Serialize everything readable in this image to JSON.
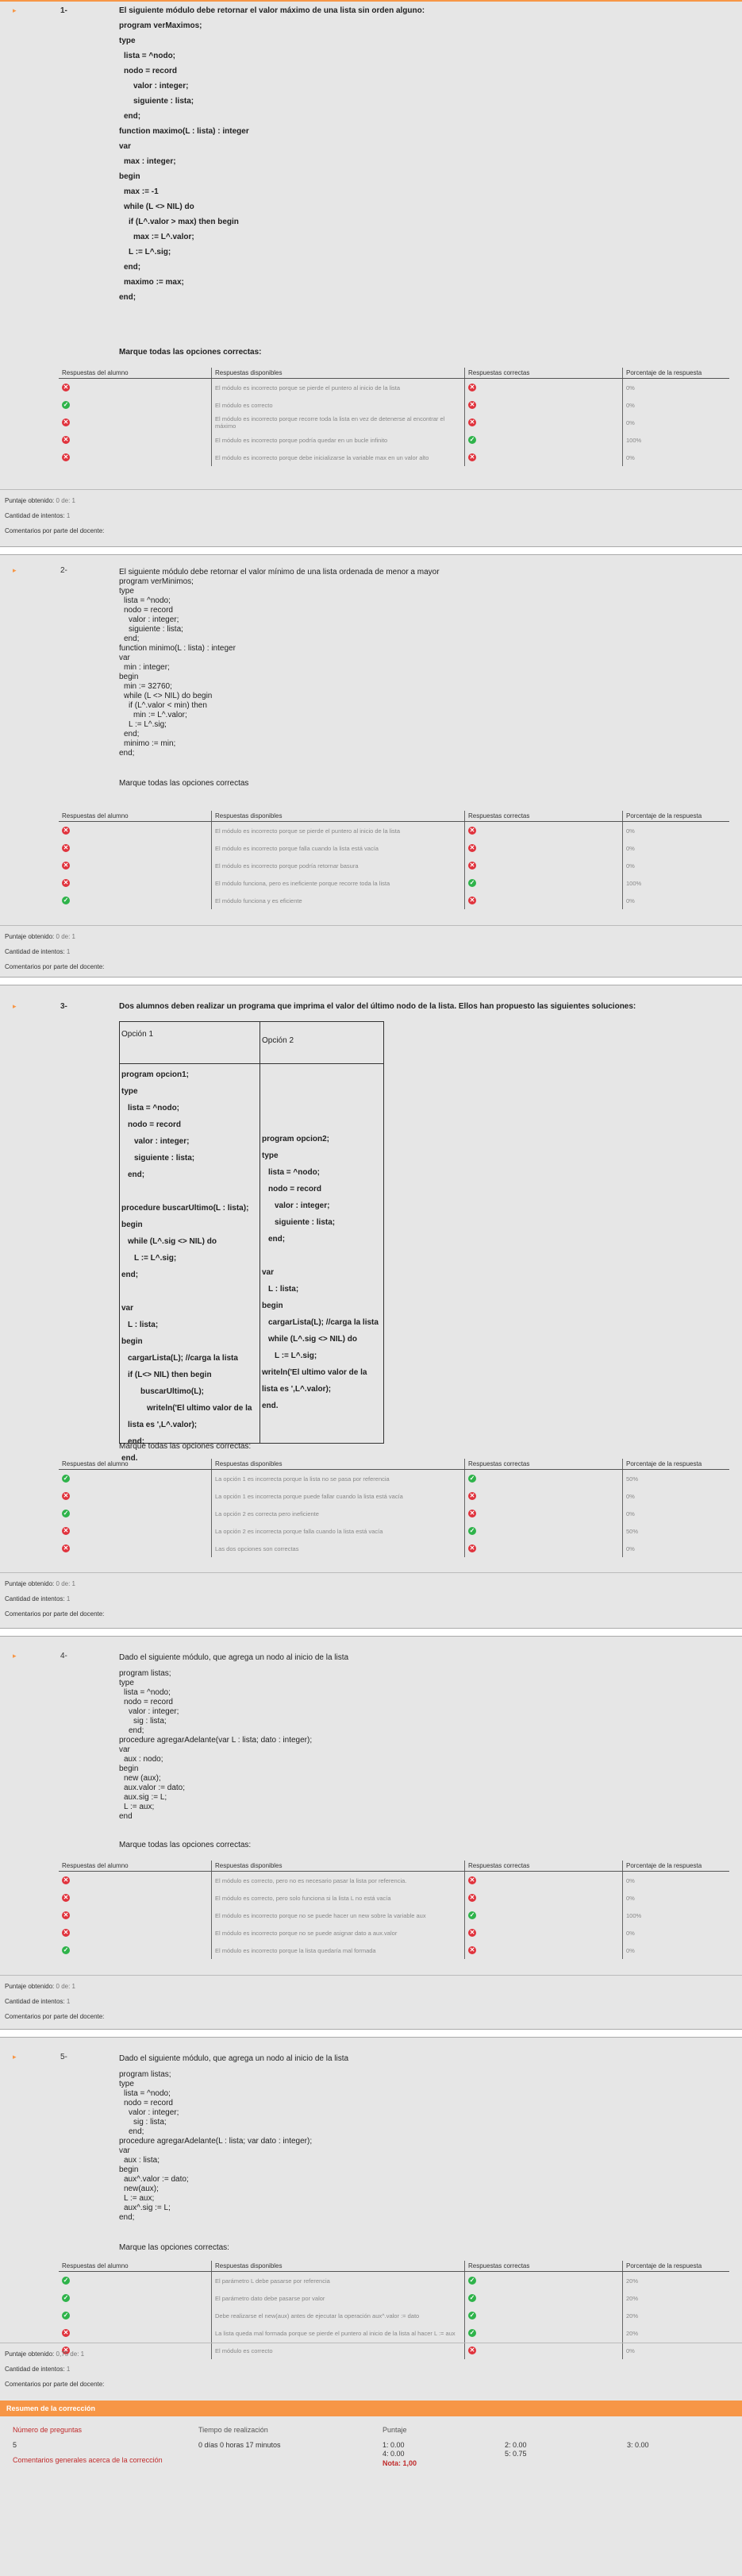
{
  "labels": {
    "student_answers": "Respuestas del alumno",
    "available_answers": "Respuestas disponibles",
    "correct_answers": "Respuestas correctas",
    "answer_percentage": "Porcentaje de la respuesta",
    "score_obtained": "Puntaje obtenido:",
    "attempts": "Cantidad de intentos:",
    "teacher_comments": "Comentarios por parte del docente:"
  },
  "q1": {
    "number": "1-",
    "statement": "El siguiente módulo debe retornar el valor máximo de una lista sin orden alguno:",
    "code": [
      "program verMaximos;",
      "type",
      "lista = ^nodo;",
      "nodo = record",
      "valor : integer;",
      "siguiente : lista;",
      "end;",
      "function maximo(L : lista) : integer",
      "var",
      "max : integer;",
      "begin",
      "max := -1",
      "while (L <> NIL) do",
      "if (L^.valor > max) then begin",
      "max := L^.valor;",
      "L := L^.sig;",
      "end;",
      "maximo := max;",
      "end;"
    ],
    "prompt": "Marque todas las opciones correctas:",
    "rows": [
      {
        "student": "bad",
        "text": "El módulo es incorrecto porque se pierde el puntero al inicio de la lista",
        "correct": "bad",
        "pct": "0%"
      },
      {
        "student": "ok",
        "text": "El módulo es correcto",
        "correct": "bad",
        "pct": "0%"
      },
      {
        "student": "bad",
        "text": "El módulo es incorrecto porque recorre toda la lista en vez de detenerse al encontrar el máximo",
        "correct": "bad",
        "pct": "0%"
      },
      {
        "student": "bad",
        "text": "El módulo es incorrecto porque podría quedar en un bucle infinito",
        "correct": "ok",
        "pct": "100%"
      },
      {
        "student": "bad",
        "text": "El módulo es incorrecto porque debe inicializarse la variable max en un valor alto",
        "correct": "bad",
        "pct": "0%"
      }
    ],
    "score": "0 de: 1",
    "attempts": "1"
  },
  "q2": {
    "number": "2-",
    "statement": "El siguiente módulo debe retornar el valor mínimo de una lista ordenada de menor a mayor",
    "code": [
      "program verMinimos;",
      "type",
      "lista = ^nodo;",
      "nodo = record",
      "valor : integer;",
      "siguiente : lista;",
      "end;",
      "function minimo(L : lista) : integer",
      "var",
      "min : integer;",
      "begin",
      "min := 32760;",
      "while (L <> NIL) do begin",
      "if (L^.valor < min) then",
      "min := L^.valor;",
      "L := L^.sig;",
      "end;",
      "minimo := min;",
      "end;"
    ],
    "prompt": "Marque todas las opciones correctas",
    "rows": [
      {
        "student": "bad",
        "text": "El módulo es incorrecto porque se pierde el puntero al inicio de la lista",
        "correct": "bad",
        "pct": "0%"
      },
      {
        "student": "bad",
        "text": "El módulo es incorrecto porque falla cuando la lista está vacía",
        "correct": "bad",
        "pct": "0%"
      },
      {
        "student": "bad",
        "text": "El módulo es incorrecto porque podría retornar basura",
        "correct": "bad",
        "pct": "0%"
      },
      {
        "student": "bad",
        "text": "El módulo funciona, pero es ineficiente porque recorre toda la lista",
        "correct": "ok",
        "pct": "100%"
      },
      {
        "student": "ok",
        "text": "El módulo funciona y es eficiente",
        "correct": "bad",
        "pct": "0%"
      }
    ],
    "score": "0 de: 1",
    "attempts": "1"
  },
  "q3": {
    "number": "3-",
    "statement": "Dos alumnos deben realizar un programa que imprima el valor del último nodo de la lista.  Ellos han propuesto las siguientes soluciones:",
    "opt1_header": "Opción 1",
    "opt2_header": "Opción 2",
    "opt1_code": [
      "program opcion1;",
      "type",
      "lista = ^nodo;",
      "nodo = record",
      "valor : integer;",
      "siguiente : lista;",
      "end;",
      "",
      "procedure buscarUltimo(L : lista);",
      "begin",
      "while (L^.sig <> NIL) do",
      "L := L^.sig;",
      "end;",
      "",
      "var",
      "L : lista;",
      "begin",
      "cargarLista(L); //carga la lista",
      "if (L<> NIL) then begin",
      "buscarUltimo(L);",
      "writeln('El ultimo valor de la",
      "lista es ',L^.valor);",
      "end;",
      "end."
    ],
    "opt2_code": [
      "program opcion2;",
      "type",
      "lista = ^nodo;",
      "nodo = record",
      "valor : integer;",
      "siguiente : lista;",
      "end;",
      "",
      "var",
      "L : lista;",
      "begin",
      "cargarLista(L); //carga la lista",
      "while (L^.sig <> NIL) do",
      "L := L^.sig;",
      "writeln('El ultimo valor de la",
      "lista es ',L^.valor);",
      "end."
    ],
    "prompt": "Marque todas las opciones correctas:",
    "rows": [
      {
        "student": "ok",
        "text": "La opción 1 es incorrecta porque la lista no se pasa por referencia",
        "correct": "ok",
        "pct": "50%"
      },
      {
        "student": "bad",
        "text": "La opción 1 es incorrecta porque puede fallar cuando la lista está vacía",
        "correct": "bad",
        "pct": "0%"
      },
      {
        "student": "ok",
        "text": "La opción 2 es correcta pero ineficiente",
        "correct": "bad",
        "pct": "0%"
      },
      {
        "student": "bad",
        "text": "La opción 2 es incorrecta porque falla cuando la lista está vacía",
        "correct": "ok",
        "pct": "50%"
      },
      {
        "student": "bad",
        "text": "Las dos opciones son correctas",
        "correct": "bad",
        "pct": "0%"
      }
    ],
    "score": "0 de: 1",
    "attempts": "1"
  },
  "q4": {
    "number": "4-",
    "statement": "Dado el siguiente módulo, que agrega un nodo al inicio de la lista",
    "code": [
      "program listas;",
      "type",
      "lista = ^nodo;",
      "nodo = record",
      "valor : integer;",
      "sig : lista;",
      "end;",
      "procedure agregarAdelante(var L : lista; dato : integer);",
      "var",
      "aux : nodo;",
      "begin",
      "new (aux);",
      "aux.valor := dato;",
      "aux.sig := L;",
      "L := aux;",
      "end"
    ],
    "prompt": "Marque todas las opciones correctas:",
    "rows": [
      {
        "student": "bad",
        "text": "El módulo es correcto, pero no es necesario pasar la lista por referencia.",
        "correct": "bad",
        "pct": "0%"
      },
      {
        "student": "bad",
        "text": "El módulo es correcto, pero solo funciona si la lista L no está vacía",
        "correct": "bad",
        "pct": "0%"
      },
      {
        "student": "bad",
        "text": "El módulo es incorrecto porque no se puede hacer un new sobre la variable aux",
        "correct": "ok",
        "pct": "100%"
      },
      {
        "student": "bad",
        "text": "El módulo es incorrecto porque no se puede asignar dato a aux.valor",
        "correct": "bad",
        "pct": "0%"
      },
      {
        "student": "ok",
        "text": "El módulo es incorrecto porque la lista quedaría mal formada",
        "correct": "bad",
        "pct": "0%"
      }
    ],
    "score": "0 de: 1",
    "attempts": "1"
  },
  "q5": {
    "number": "5-",
    "statement": "Dado el siguiente módulo, que agrega un nodo al inicio de la lista",
    "code": [
      "program listas;",
      "type",
      "lista = ^nodo;",
      "nodo = record",
      "valor : integer;",
      "sig : lista;",
      "end;",
      "procedure agregarAdelante(L : lista; var dato : integer);",
      "var",
      "aux : lista;",
      "begin",
      "aux^.valor := dato;",
      "new(aux);",
      "L := aux;",
      "aux^.sig := L;",
      "end;"
    ],
    "prompt": "Marque las opciones correctas:",
    "rows": [
      {
        "student": "ok",
        "text": "El parámetro L debe pasarse por referencia",
        "correct": "ok",
        "pct": "20%"
      },
      {
        "student": "ok",
        "text": "El parámetro dato debe pasarse por valor",
        "correct": "ok",
        "pct": "20%"
      },
      {
        "student": "ok",
        "text": "Debe realizarse el new(aux) antes de ejecutar la operación aux^.valor := dato",
        "correct": "ok",
        "pct": "20%"
      },
      {
        "student": "bad",
        "text": "La lista queda mal formada porque se pierde el puntero al inicio de la lista al hacer L := aux",
        "correct": "ok",
        "pct": "20%"
      },
      {
        "student": "bad",
        "text": "El módulo es correcto",
        "correct": "bad",
        "pct": "0%"
      }
    ],
    "score": "0,75 de: 1",
    "attempts": "1"
  },
  "summary": {
    "title": "Resumen de la corrección",
    "num_questions_label": "Número de preguntas",
    "num_questions": "5",
    "time_label": "Tiempo de realización",
    "time": "0 días 0 horas 17 minutos",
    "score_label": "Puntaje",
    "scores": [
      "1: 0.00",
      "2: 0.00",
      "3: 0.00",
      "4: 0.00",
      "5: 0.75"
    ],
    "grade": "Nota: 1,00",
    "comments_label": "Comentarios generales acerca de la corrección"
  }
}
